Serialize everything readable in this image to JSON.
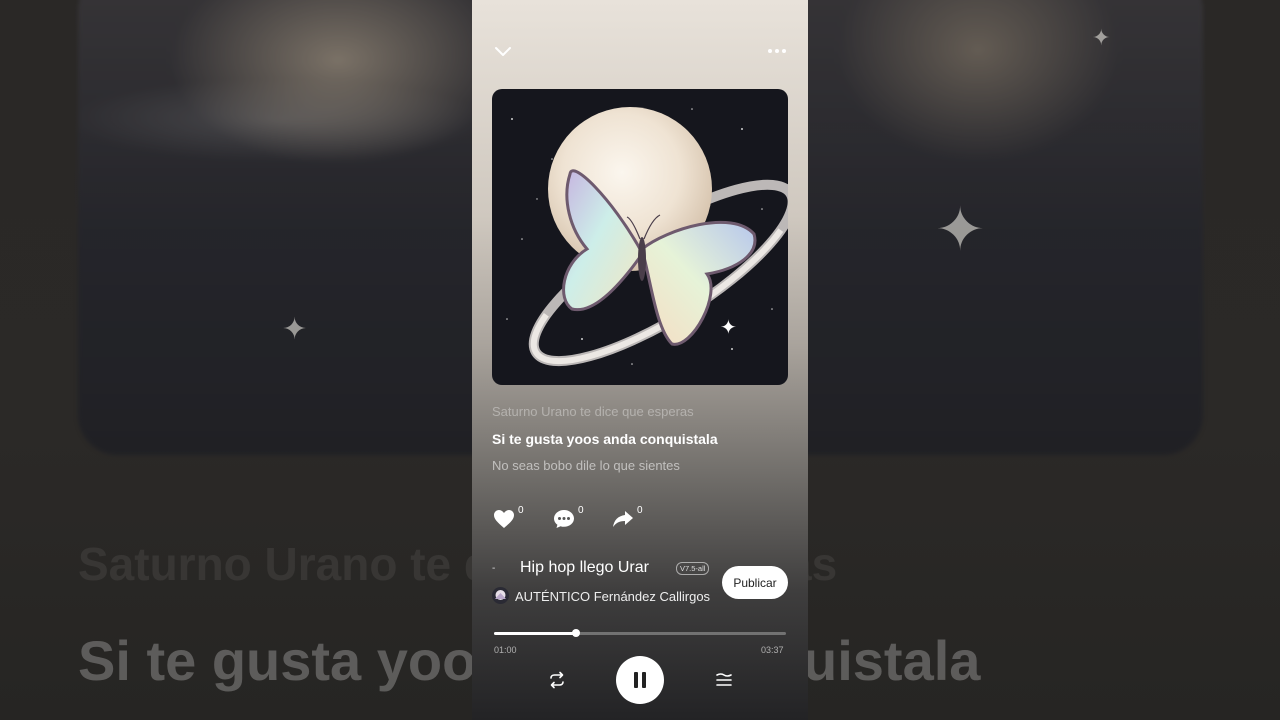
{
  "background": {
    "lyric_previous": "Saturno Urano te dice que esperas",
    "lyric_current": "Si te gusta yoos anda conquistala"
  },
  "header": {
    "collapse_icon": "chevron-down-icon",
    "more_icon": "more-dots-icon"
  },
  "cover": {
    "description_icon": "album-cover-saturn-butterfly"
  },
  "lyrics": {
    "previous": "Saturno Urano te dice que esperas",
    "current": "Si te gusta yoos anda conquistala",
    "next": "No seas bobo dile lo que sientes"
  },
  "actions": {
    "like_count": "0",
    "comment_count": "0",
    "share_count": "0"
  },
  "track": {
    "marker": "-",
    "title": "Hip hop llego Urar",
    "version": "V7.5-all",
    "artist": "AUTÉNTICO Fernández Callirgos"
  },
  "publish_label": "Publicar",
  "progress": {
    "elapsed": "01:00",
    "total": "03:37",
    "fraction": 0.28
  },
  "colors": {
    "accent": "#ffffff",
    "panel_top": "#e8e2da",
    "panel_bottom": "#232325"
  }
}
